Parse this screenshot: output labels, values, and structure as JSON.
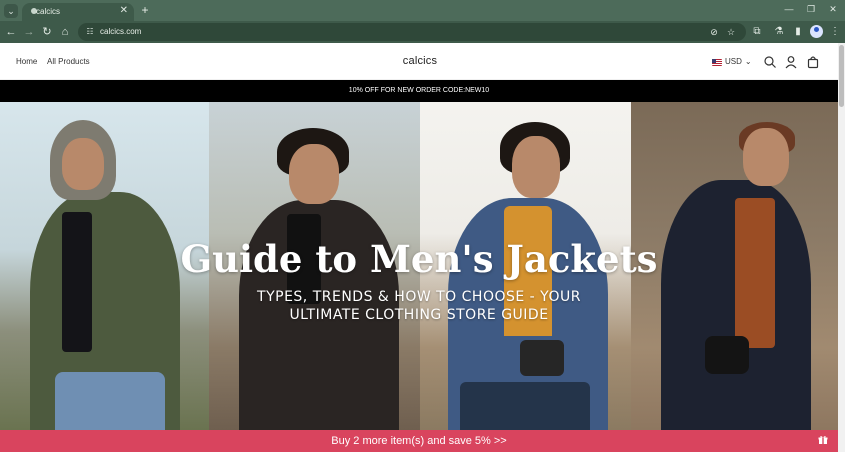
{
  "browser": {
    "tab_title": "calcics",
    "new_tab": "+",
    "url": "calcics.com",
    "window_controls": {
      "minimize": "—",
      "restore": "❐",
      "close": "✕"
    }
  },
  "site": {
    "nav": [
      "Home",
      "All Products"
    ],
    "logo": "calcics",
    "currency": "USD",
    "announcement": "10% OFF FOR NEW ORDER CODE:NEW10"
  },
  "hero": {
    "title": "Guide to Men's Jackets",
    "subtitle_line1": "TYPES, TRENDS & HOW TO CHOOSE - YOUR",
    "subtitle_line2": "ULTIMATE CLOTHING STORE GUIDE"
  },
  "promo_bar": {
    "text": "Buy 2 more item(s) and save 5%  >>"
  },
  "colors": {
    "chrome": "#4d6b5a",
    "toolbar": "#3e5a4a",
    "announcement_bg": "#000000",
    "promo_bg": "#d9445e"
  },
  "icons": {
    "search": "search-icon",
    "account": "account-icon",
    "cart": "cart-icon",
    "gift": "gift-icon"
  }
}
